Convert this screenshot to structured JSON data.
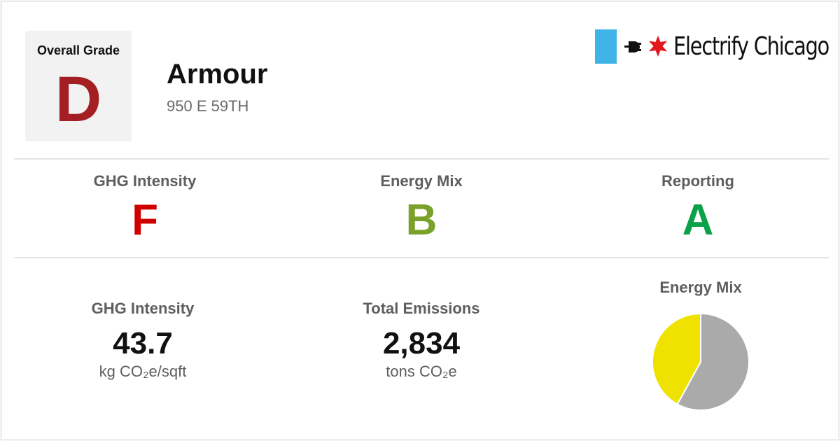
{
  "header": {
    "overall_grade_label": "Overall Grade",
    "overall_grade": "D",
    "building_name": "Armour",
    "address": "950 E 59TH"
  },
  "logo": {
    "text": "Electrify Chicago",
    "square_icon": "light-blue-square",
    "plug_icon": "electric-plug-icon",
    "star_icon": "chicago-star-icon"
  },
  "grades": [
    {
      "label": "GHG Intensity",
      "letter": "F"
    },
    {
      "label": "Energy Mix",
      "letter": "B"
    },
    {
      "label": "Reporting",
      "letter": "A"
    }
  ],
  "stats": {
    "ghg_intensity": {
      "label": "GHG Intensity",
      "value": "43.7",
      "unit": "kg CO₂e/sqft"
    },
    "total_emissions": {
      "label": "Total Emissions",
      "value": "2,834",
      "unit": "tons CO₂e"
    }
  },
  "energy_mix": {
    "title": "Energy Mix"
  },
  "chart_data": {
    "type": "pie",
    "title": "Energy Mix",
    "slices": [
      {
        "value": 0.42,
        "color": "#efe200"
      },
      {
        "value": 0.58,
        "color": "#aaaaaa"
      }
    ]
  },
  "colors": {
    "grade_D": "#a31f24",
    "grade_F": "#d10000",
    "grade_B": "#7aa12a",
    "grade_A": "#0ba14a",
    "logo_square": "#40b4e6",
    "logo_star": "#e2171b",
    "label_gray": "#5e5e5e",
    "divider": "#e4e4e4"
  }
}
